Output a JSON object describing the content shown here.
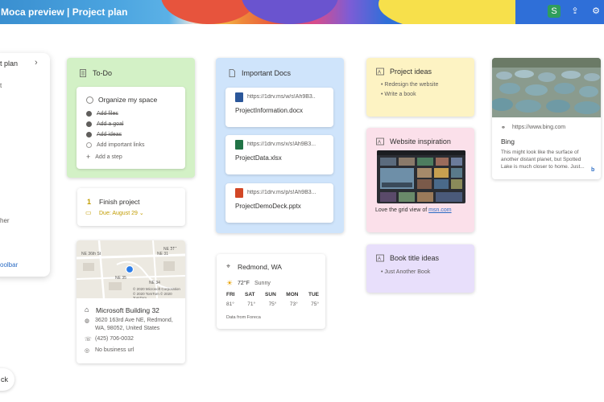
{
  "window": {
    "title": "Moca preview | Project plan",
    "buttons": [
      {
        "name": "skype",
        "glyph": "S"
      },
      {
        "name": "share",
        "glyph": "⇪"
      },
      {
        "name": "settings",
        "glyph": "⚙"
      }
    ]
  },
  "left_panel": {
    "title": "t plan",
    "items": [
      "t",
      "her"
    ],
    "toolbar_label": "oolbar"
  },
  "back_button": {
    "label": "ck"
  },
  "todo": {
    "title": "To-Do",
    "header_item": "Organize my space",
    "items": [
      {
        "label": "Add files",
        "done": true
      },
      {
        "label": "Add a goal",
        "done": true
      },
      {
        "label": "Add ideas",
        "done": true
      },
      {
        "label": "Add important links",
        "done": false
      }
    ],
    "add_step": "Add a step"
  },
  "finish_project": {
    "number": "1",
    "title": "Finish project",
    "due": "Due: August 29"
  },
  "map_card": {
    "place_name": "Microsoft Building 32",
    "address_line1": "3620 163rd Ave NE, Redmond,",
    "address_line2": "WA, 98052, United States",
    "phone": "(425) 706-0032",
    "website": "No business url",
    "map_labels": [
      "NE 37",
      "NE 36th St",
      "NE 35",
      "NE 34",
      "NE 31"
    ],
    "map_copyright": "© 2020 Microsoft Corporation",
    "map_copyright2": "© 2020 TomTom © 2020 TomTom"
  },
  "important_docs": {
    "title": "Important Docs",
    "docs": [
      {
        "link": "https://1drv.ms/w/s!Ah9B3...",
        "name": "ProjectInformation.docx",
        "color": "#2b579a"
      },
      {
        "link": "https://1drv.ms/x/s!Ah9B3...",
        "name": "ProjectData.xlsx",
        "color": "#217346"
      },
      {
        "link": "https://1drv.ms/p/s!Ah9B3...",
        "name": "ProjectDemoDeck.pptx",
        "color": "#d24726"
      }
    ]
  },
  "weather": {
    "location": "Redmond, WA",
    "current_temp": "72°F",
    "condition": "Sunny",
    "days": [
      {
        "day": "FRI",
        "temp": "81°"
      },
      {
        "day": "SAT",
        "temp": "71°"
      },
      {
        "day": "SUN",
        "temp": "75°"
      },
      {
        "day": "MON",
        "temp": "73°"
      },
      {
        "day": "TUE",
        "temp": "75°"
      }
    ],
    "source": "Data from Foreca"
  },
  "project_ideas": {
    "title": "Project ideas",
    "items": [
      "Redesign the website",
      "Write a book"
    ]
  },
  "website_inspiration": {
    "title": "Website inspiration",
    "caption_prefix": "Love the grid view of ",
    "caption_link": "msn.com"
  },
  "book_ideas": {
    "title": "Book title ideas",
    "items": [
      "Just Another Book"
    ]
  },
  "bing_card": {
    "url": "https://www.bing.com",
    "title": "Bing",
    "description": "This might look like the surface of another distant planet, but Spotted Lake is much closer to home. Just...",
    "logo": "b"
  },
  "colors": {
    "todo_bg": "#d3f1c6",
    "docs_bg": "#cfe4fb",
    "ideas_bg": "#fdf3c3",
    "inspiration_bg": "#fbe0ea",
    "book_bg": "#e8dffb",
    "accent_blue": "#2b6cc4",
    "due_orange": "#c19c00"
  }
}
